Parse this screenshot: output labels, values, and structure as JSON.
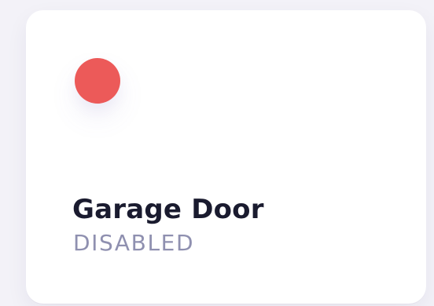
{
  "card": {
    "title": "Garage Door",
    "status": "DISABLED",
    "status_dot_color": "#ec5a59",
    "status_dot_icon": "status-dot-icon"
  }
}
